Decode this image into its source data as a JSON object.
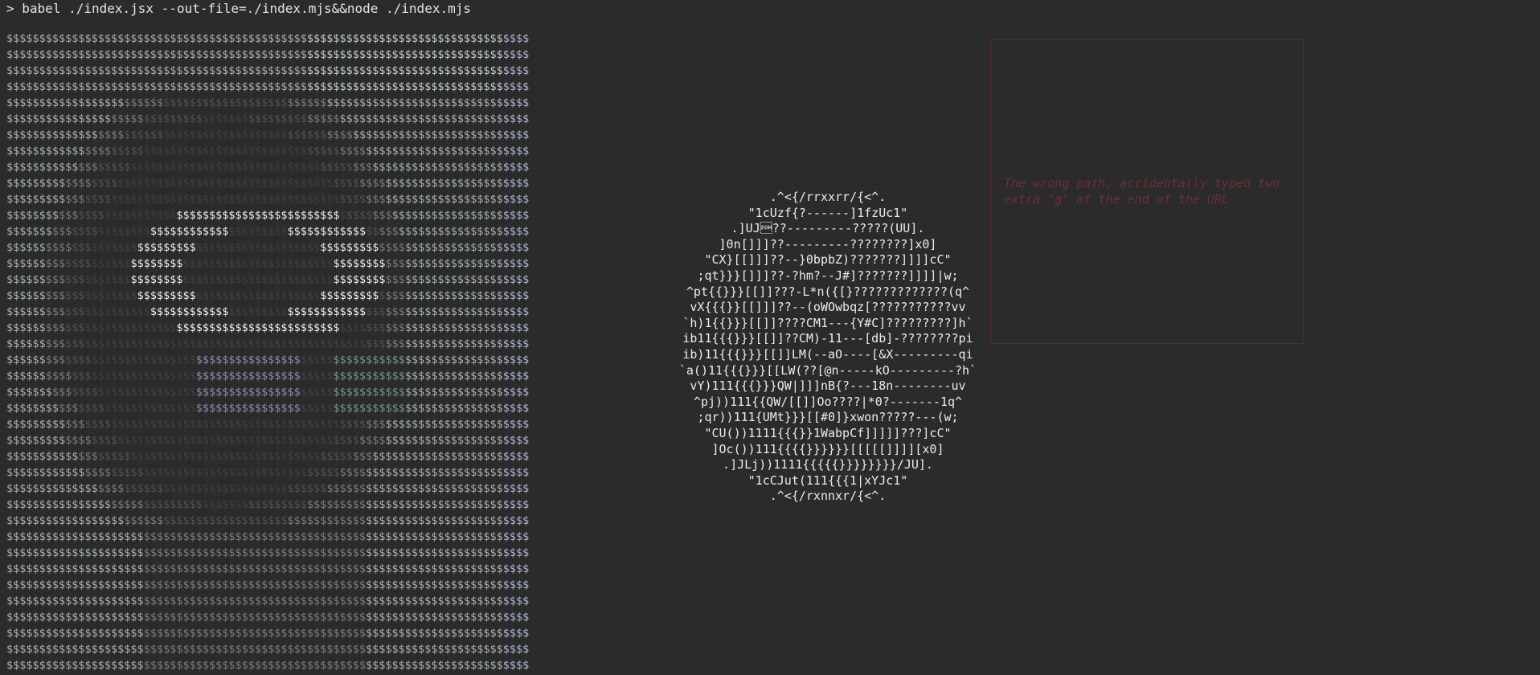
{
  "terminal": {
    "prompt_symbol": ">",
    "command": "babel ./index.jsx --out-file=./index.mjs&&node ./index.mjs"
  },
  "ascii_art": {
    "char": "$",
    "colors": {
      "bright_light": "#c4d2d4",
      "light": "#a9b4b6",
      "mid": "#7a7f80",
      "dark": "#505354",
      "darker": "#3e4041",
      "white": "#f2f2f2",
      "purple": "#9a86b3",
      "green": "#6f9a86",
      "blue_edge": "#aeb9d8"
    }
  },
  "ascii_ball": {
    "lines": [
      ".^<{/rrxxrr/{<^.",
      "\"1cUzf{?------]1fzUc1\"",
      ".]UJ\u0001??---------?????(UU].",
      "]0n[]]]??---------????????]x0]",
      "\"CX}[[]]]??--}0bpbZ)???????]]]]cC\"",
      ";qt}}}[]]]??-?hm?--J#]???????]]]]|w;",
      "^pt{{}}}[[]]???-L*n({[}?????????????(q^",
      "vX{{{}}[[]]]??--(oWOwbqz[???????????vv",
      "`h)1{{}}}[[]]????CM1---{Y#C]?????????]h`",
      "ib11{{{}}}[[]]??CM)-11---[db]-????????pi",
      "ib)11{{{}}}[[]]LM(--aO----[&X---------qi",
      "`a()11{{{}}}[[LW(??[@n-----kO---------?h`",
      "vY)111{{{}}}QW|]]]nB{?---18n--------uv",
      "^pj))111{{QW/[[]]Oo????|*0?-------1q^",
      ";qr))111{UMt}}}[[#0]}xwon?????---(w;",
      "\"CU())1111{{{}}1WabpCf]]]]]???]cC\"",
      "]Oc())111{{{{}}}}}}[[[[[]]]][x0]",
      ".]JLj))1111{{{{{}}}}}}}}/JU].",
      "\"1cCJut(111{{{1|xYJc1\"",
      ".^<{/rxnnxr/{<^."
    ]
  },
  "error_panel": {
    "message": "The wrong path, accidentally typed two extra \"g\" at the end of the URL",
    "accent": "#6b2f36"
  }
}
